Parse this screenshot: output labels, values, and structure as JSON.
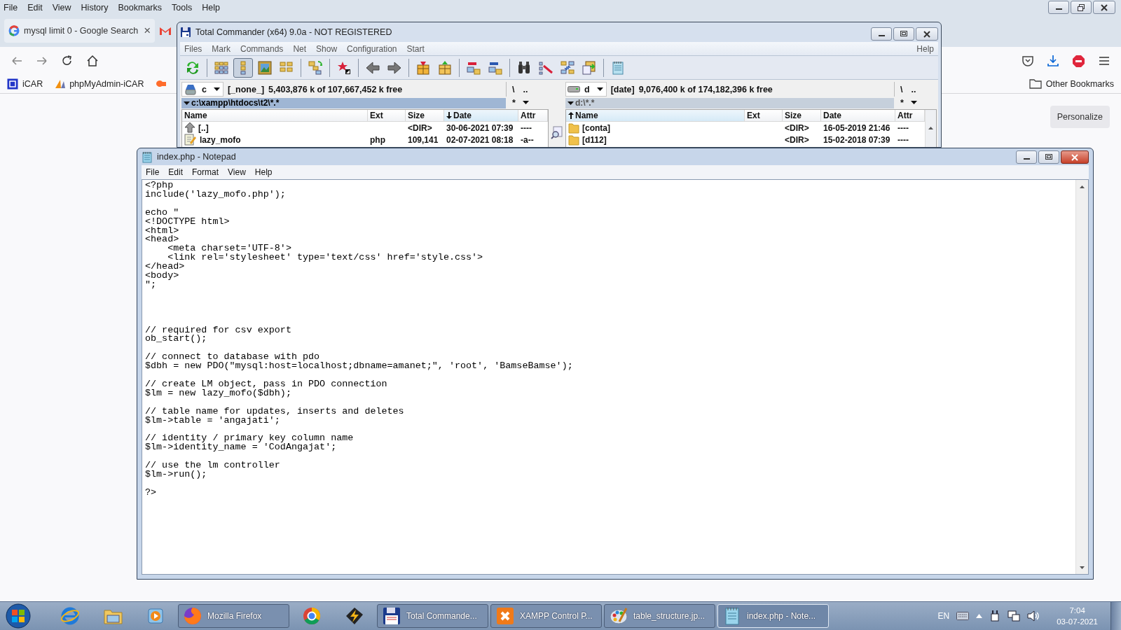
{
  "browser": {
    "menu": [
      "File",
      "Edit",
      "View",
      "History",
      "Bookmarks",
      "Tools",
      "Help"
    ],
    "tabs": [
      {
        "title": "mysql limit 0 - Google Search",
        "close": "×",
        "selected": true
      },
      {
        "selected": false
      }
    ],
    "bookmarks": [
      {
        "kind": "link",
        "label": "iCAR"
      },
      {
        "kind": "link",
        "label": "phpMyAdmin-iCAR"
      },
      {
        "kind": "icon"
      }
    ],
    "other_bookmarks": "Other Bookmarks",
    "personalize": "Personalize"
  },
  "total_commander": {
    "title": "Total Commander (x64) 9.0a - NOT REGISTERED",
    "menu": [
      "Files",
      "Mark",
      "Commands",
      "Net",
      "Show",
      "Configuration",
      "Start"
    ],
    "help": "Help",
    "toolbar": [
      {
        "kind": "button",
        "pressed": false
      },
      {
        "kind": "separator"
      },
      {
        "kind": "button",
        "pressed": false
      },
      {
        "kind": "button",
        "pressed": true
      },
      {
        "kind": "button",
        "pressed": false
      },
      {
        "kind": "button",
        "pressed": false
      },
      {
        "kind": "separator"
      },
      {
        "kind": "button",
        "pressed": false
      },
      {
        "kind": "separator"
      },
      {
        "kind": "button",
        "pressed": false
      },
      {
        "kind": "separator"
      },
      {
        "kind": "button",
        "pressed": false
      },
      {
        "kind": "button",
        "pressed": false
      },
      {
        "kind": "separator"
      },
      {
        "kind": "button",
        "pressed": false
      },
      {
        "kind": "button",
        "pressed": false
      },
      {
        "kind": "separator"
      },
      {
        "kind": "button",
        "pressed": false
      },
      {
        "kind": "button",
        "pressed": false
      },
      {
        "kind": "separator"
      },
      {
        "kind": "button",
        "pressed": false
      },
      {
        "kind": "button",
        "pressed": false
      },
      {
        "kind": "button",
        "pressed": false
      },
      {
        "kind": "button",
        "pressed": false
      },
      {
        "kind": "separator"
      },
      {
        "kind": "button",
        "pressed": false
      }
    ],
    "panels": [
      {
        "active": true,
        "drive": "c",
        "label": "[_none_]",
        "free": "5,403,876 k of 107,667,452 k free",
        "root": "\\",
        "up": "..",
        "path": "c:\\xampp\\htdocs\\t2\\*.*",
        "filter": "*",
        "columns": [
          {
            "label": "Name",
            "sorted": false
          },
          {
            "label": "Ext",
            "sorted": false
          },
          {
            "label": "Size",
            "sorted": false
          },
          {
            "label": "Date",
            "sorted": true,
            "descending": true
          },
          {
            "label": "Attr",
            "sorted": false
          }
        ],
        "rows": [
          {
            "kind": "up",
            "name": "[..]",
            "size": "<DIR>",
            "date": "30-06-2021 07:39",
            "attr": "----"
          },
          {
            "kind": "file",
            "name": "lazy_mofo",
            "ext": "php",
            "size": "109,141",
            "date": "02-07-2021 08:18",
            "attr": "-a--"
          }
        ]
      },
      {
        "active": false,
        "drive": "d",
        "label": "[date]",
        "free": "9,076,400 k of 174,182,396 k free",
        "root": "\\",
        "up": "..",
        "path": "d:\\*.*",
        "filter": "*",
        "scrollbar": true,
        "columns": [
          {
            "label": "Name",
            "sorted": true,
            "descending": false
          },
          {
            "label": "Ext",
            "sorted": false
          },
          {
            "label": "Size",
            "sorted": false
          },
          {
            "label": "Date",
            "sorted": false
          },
          {
            "label": "Attr",
            "sorted": false
          }
        ],
        "rows": [
          {
            "kind": "folder",
            "name": "[conta]",
            "size": "<DIR>",
            "date": "16-05-2019 21:46",
            "attr": "----"
          },
          {
            "kind": "folder",
            "name": "[d112]",
            "size": "<DIR>",
            "date": "15-02-2018 07:39",
            "attr": "----"
          }
        ]
      }
    ]
  },
  "notepad": {
    "title": "index.php - Notepad",
    "menu": [
      "File",
      "Edit",
      "Format",
      "View",
      "Help"
    ],
    "text": "<?php\ninclude('lazy_mofo.php');\n\necho \"\n<!DOCTYPE html>\n<html>\n<head>\n    <meta charset='UTF-8'>\n    <link rel='stylesheet' type='text/css' href='style.css'>\n</head>\n<body>\n\";\n\n\n\n\n// required for csv export\nob_start();\n\n// connect to database with pdo\n$dbh = new PDO(\"mysql:host=localhost;dbname=amanet;\", 'root', 'BamseBamse');\n\n// create LM object, pass in PDO connection\n$lm = new lazy_mofo($dbh);\n\n// table name for updates, inserts and deletes\n$lm->table = 'angajati';\n\n// identity / primary key column name\n$lm->identity_name = 'CodAngajat';\n\n// use the lm controller\n$lm->run();\n\n?>"
  },
  "taskbar": {
    "items": [
      {
        "kind": "pinned"
      },
      {
        "kind": "pinned"
      },
      {
        "kind": "pinned"
      },
      {
        "kind": "task",
        "label": "Mozilla Firefox",
        "active": false
      },
      {
        "kind": "pinned"
      },
      {
        "kind": "pinned"
      },
      {
        "kind": "task",
        "label": "Total Commande...",
        "active": false
      },
      {
        "kind": "task",
        "label": "XAMPP Control P...",
        "active": false
      },
      {
        "kind": "task",
        "label": "table_structure.jp...",
        "active": false
      },
      {
        "kind": "task",
        "label": "index.php - Note...",
        "active": true
      }
    ],
    "language": "EN",
    "time": "7:04",
    "date": "03-07-2021"
  }
}
